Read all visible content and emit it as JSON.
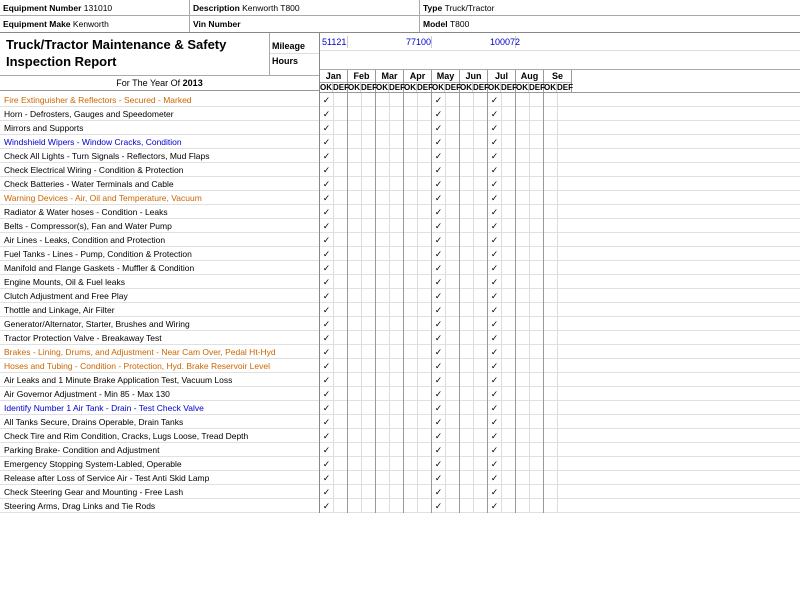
{
  "header": {
    "equipment_number_label": "Equipment Number",
    "equipment_number_value": "131010",
    "equipment_make_label": "Equipment Make",
    "equipment_make_value": "Kenworth",
    "description_label": "Description",
    "description_value": "Kenworth T800",
    "vin_number_label": "Vin Number",
    "vin_number_value": "",
    "type_label": "Type",
    "type_value": "Truck/Tractor",
    "model_label": "Model",
    "model_value": "T800"
  },
  "report": {
    "title_line1": "Truck/Tractor Maintenance & Safety",
    "title_line2": "Inspection Report",
    "year_label": "For The Year Of",
    "year_value": "2013",
    "mileage_label": "Mileage",
    "hours_label": "Hours"
  },
  "mileage_values": [
    "51121",
    "",
    "77100",
    "",
    "100072",
    ""
  ],
  "months": [
    "Jan",
    "Feb",
    "Mar",
    "Apr",
    "May",
    "Jun",
    "Jul",
    "Aug",
    "Se"
  ],
  "col_headers": [
    "OK",
    "DEF",
    "OK",
    "DEF",
    "OK",
    "DEF",
    "OK",
    "DEF",
    "OK",
    "DEF",
    "OK",
    "DEF",
    "OK",
    "DEF",
    "OK",
    "DEF",
    "OK",
    "DEF"
  ],
  "items": [
    {
      "text": "Fire Extinguisher & Reflectors - Secured - Marked",
      "color": "orange"
    },
    {
      "text": "Horn - Defrosters, Gauges and Speedometer",
      "color": "black"
    },
    {
      "text": "Mirrors and Supports",
      "color": "black"
    },
    {
      "text": "Windshield Wipers - Window Cracks, Condition",
      "color": "blue"
    },
    {
      "text": "Check All Lights - Turn Signals - Reflectors, Mud Flaps",
      "color": "black"
    },
    {
      "text": "Check Electrical Wiring - Condition & Protection",
      "color": "black"
    },
    {
      "text": "Check Batteries - Water Terminals and Cable",
      "color": "black"
    },
    {
      "text": "Warning Devices - Air, Oil and Temperature, Vacuum",
      "color": "orange"
    },
    {
      "text": "Radiator & Water hoses - Condition - Leaks",
      "color": "black"
    },
    {
      "text": "Belts - Compressor(s), Fan and Water Pump",
      "color": "black"
    },
    {
      "text": "Air Lines - Leaks, Condition and Protection",
      "color": "black"
    },
    {
      "text": "Fuel Tanks - Lines - Pump, Condition & Protection",
      "color": "black"
    },
    {
      "text": "Manifold and Flange Gaskets - Muffler & Condition",
      "color": "black"
    },
    {
      "text": "Engine Mounts, Oil & Fuel leaks",
      "color": "black"
    },
    {
      "text": "Clutch Adjustment and Free Play",
      "color": "black"
    },
    {
      "text": "Thottle and Linkage, Air Filter",
      "color": "black"
    },
    {
      "text": "Generator/Alternator, Starter, Brushes and Wiring",
      "color": "black"
    },
    {
      "text": "Tractor Protection Valve - Breakaway Test",
      "color": "black"
    },
    {
      "text": "Brakes - Lining, Drums, and Adjustment - Near Cam Over, Pedal Ht-Hyd",
      "color": "orange"
    },
    {
      "text": "Hoses and Tubing - Condition - Protection, Hyd. Brake Reservoir Level",
      "color": "orange"
    },
    {
      "text": "Air Leaks and 1 Minute Brake Application Test, Vacuum Loss",
      "color": "black"
    },
    {
      "text": "Air Governor Adjustment - Min 85 - Max 130",
      "color": "black"
    },
    {
      "text": "Identify Number 1 Air Tank - Drain - Test Check Valve",
      "color": "blue"
    },
    {
      "text": "All Tanks Secure, Drains Operable, Drain Tanks",
      "color": "black"
    },
    {
      "text": "Check Tire and Rim Condition, Cracks, Lugs Loose, Tread Depth",
      "color": "black"
    },
    {
      "text": "Parking Brake- Condition and Adjustment",
      "color": "black"
    },
    {
      "text": "Emergency Stopping System-Labled, Operable",
      "color": "black"
    },
    {
      "text": "Release after Loss of Service Air - Test Anti Skid Lamp",
      "color": "black"
    },
    {
      "text": "Check Steering Gear and Mounting - Free Lash",
      "color": "black"
    },
    {
      "text": "Steering Arms, Drag Links and Tie Rods",
      "color": "black"
    }
  ],
  "checks": [
    [
      1,
      0,
      0,
      0,
      0,
      0,
      0,
      0,
      1,
      0,
      0,
      0,
      1,
      0,
      0,
      0
    ],
    [
      1,
      0,
      0,
      0,
      0,
      0,
      0,
      0,
      1,
      0,
      0,
      0,
      1,
      0,
      0,
      0
    ],
    [
      1,
      0,
      0,
      0,
      0,
      0,
      0,
      0,
      1,
      0,
      0,
      0,
      1,
      0,
      0,
      0
    ],
    [
      1,
      0,
      0,
      0,
      0,
      0,
      0,
      0,
      1,
      0,
      0,
      0,
      1,
      0,
      0,
      0
    ],
    [
      1,
      0,
      0,
      0,
      0,
      0,
      0,
      0,
      1,
      0,
      0,
      0,
      1,
      0,
      0,
      0
    ],
    [
      1,
      0,
      0,
      0,
      0,
      0,
      0,
      0,
      1,
      0,
      0,
      0,
      1,
      0,
      0,
      0
    ],
    [
      1,
      0,
      0,
      0,
      0,
      0,
      0,
      0,
      1,
      0,
      0,
      0,
      1,
      0,
      0,
      0
    ],
    [
      1,
      0,
      0,
      0,
      0,
      0,
      0,
      0,
      1,
      0,
      0,
      0,
      1,
      0,
      0,
      0
    ],
    [
      1,
      0,
      0,
      0,
      0,
      0,
      0,
      0,
      1,
      0,
      0,
      0,
      1,
      0,
      0,
      0
    ],
    [
      1,
      0,
      0,
      0,
      0,
      0,
      0,
      0,
      1,
      0,
      0,
      0,
      1,
      0,
      0,
      0
    ],
    [
      1,
      0,
      0,
      0,
      0,
      0,
      0,
      0,
      1,
      0,
      0,
      0,
      1,
      0,
      0,
      0
    ],
    [
      1,
      0,
      0,
      0,
      0,
      0,
      0,
      0,
      1,
      0,
      0,
      0,
      1,
      0,
      0,
      0
    ],
    [
      1,
      0,
      0,
      0,
      0,
      0,
      0,
      0,
      1,
      0,
      0,
      0,
      1,
      0,
      0,
      0
    ],
    [
      1,
      0,
      0,
      0,
      0,
      0,
      0,
      0,
      1,
      0,
      0,
      0,
      1,
      0,
      0,
      0
    ],
    [
      1,
      0,
      0,
      0,
      0,
      0,
      0,
      0,
      1,
      0,
      0,
      0,
      1,
      0,
      0,
      0
    ],
    [
      1,
      0,
      0,
      0,
      0,
      0,
      0,
      0,
      1,
      0,
      0,
      0,
      1,
      0,
      0,
      0
    ],
    [
      1,
      0,
      0,
      0,
      0,
      0,
      0,
      0,
      1,
      0,
      0,
      0,
      1,
      0,
      0,
      0
    ],
    [
      1,
      0,
      0,
      0,
      0,
      0,
      0,
      0,
      1,
      0,
      0,
      0,
      1,
      0,
      0,
      0
    ],
    [
      1,
      0,
      0,
      0,
      0,
      0,
      0,
      0,
      1,
      0,
      0,
      0,
      1,
      0,
      0,
      0
    ],
    [
      1,
      0,
      0,
      0,
      0,
      0,
      0,
      0,
      1,
      0,
      0,
      0,
      1,
      0,
      0,
      0
    ],
    [
      1,
      0,
      0,
      0,
      0,
      0,
      0,
      0,
      1,
      0,
      0,
      0,
      1,
      0,
      0,
      0
    ],
    [
      1,
      0,
      0,
      0,
      0,
      0,
      0,
      0,
      1,
      0,
      0,
      0,
      1,
      0,
      0,
      0
    ],
    [
      1,
      0,
      0,
      0,
      0,
      0,
      0,
      0,
      1,
      0,
      0,
      0,
      1,
      0,
      0,
      0
    ],
    [
      1,
      0,
      0,
      0,
      0,
      0,
      0,
      0,
      1,
      0,
      0,
      0,
      1,
      0,
      0,
      0
    ],
    [
      1,
      0,
      0,
      0,
      0,
      0,
      0,
      0,
      1,
      0,
      0,
      0,
      1,
      0,
      0,
      0
    ],
    [
      1,
      0,
      0,
      0,
      0,
      0,
      0,
      0,
      1,
      0,
      0,
      0,
      1,
      0,
      0,
      0
    ],
    [
      1,
      0,
      0,
      0,
      0,
      0,
      0,
      0,
      1,
      0,
      0,
      0,
      1,
      0,
      0,
      0
    ],
    [
      1,
      0,
      0,
      0,
      0,
      0,
      0,
      0,
      1,
      0,
      0,
      0,
      1,
      0,
      0,
      0
    ],
    [
      1,
      0,
      0,
      0,
      0,
      0,
      0,
      0,
      1,
      0,
      0,
      0,
      1,
      0,
      0,
      0
    ],
    [
      1,
      0,
      0,
      0,
      0,
      0,
      0,
      0,
      1,
      0,
      0,
      0,
      1,
      0,
      0,
      0
    ]
  ]
}
